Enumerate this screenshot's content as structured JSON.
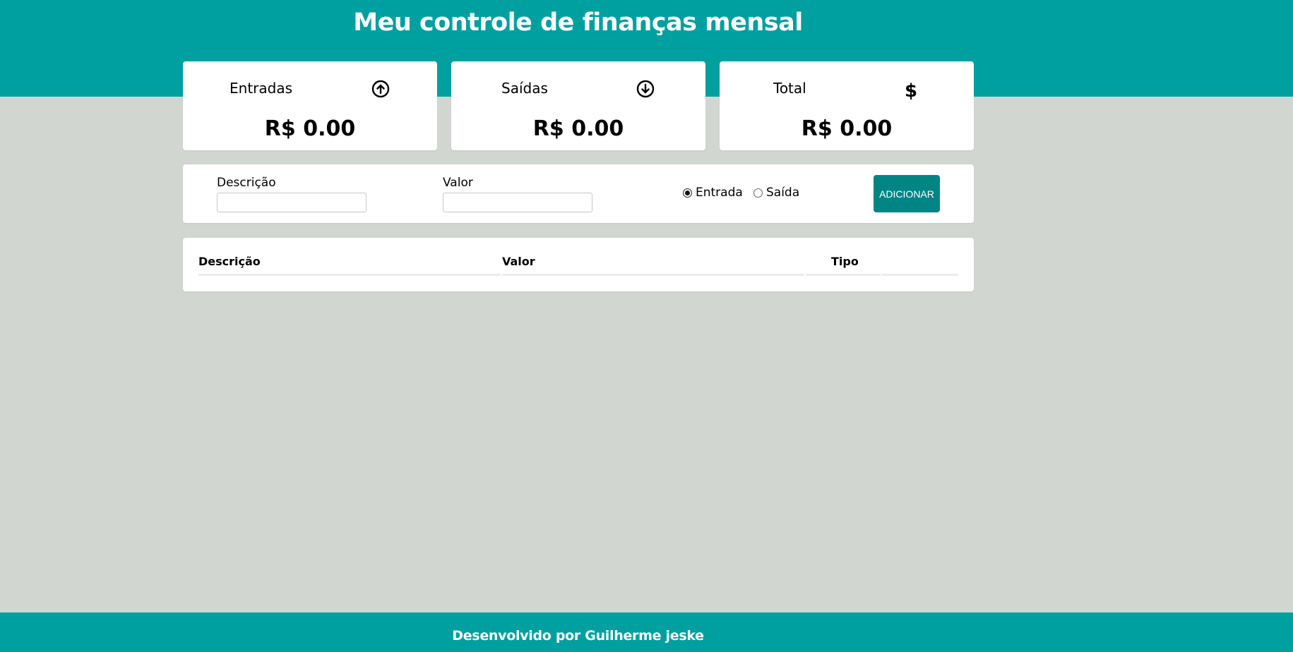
{
  "header": {
    "title": "Meu controle de finanças mensal"
  },
  "summary": {
    "entradas": {
      "label": "Entradas",
      "value": "R$ 0.00",
      "icon": "arrow-up-circle-icon"
    },
    "saidas": {
      "label": "Saídas",
      "value": "R$ 0.00",
      "icon": "arrow-down-circle-icon"
    },
    "total": {
      "label": "Total",
      "value": "R$ 0.00",
      "icon": "dollar-icon"
    }
  },
  "form": {
    "descricao_label": "Descrição",
    "descricao_value": "",
    "valor_label": "Valor",
    "valor_value": "",
    "radio_entrada": "Entrada",
    "radio_saida": "Saída",
    "selected_type": "Entrada",
    "add_button": "ADICIONAR"
  },
  "table": {
    "headers": [
      "Descrição",
      "Valor",
      "Tipo"
    ]
  },
  "footer": {
    "text": "Desenvolvido por Guilherme jeske"
  },
  "colors": {
    "teal": "#00a0a0",
    "button": "#008585",
    "background": "#d1d6d0"
  }
}
